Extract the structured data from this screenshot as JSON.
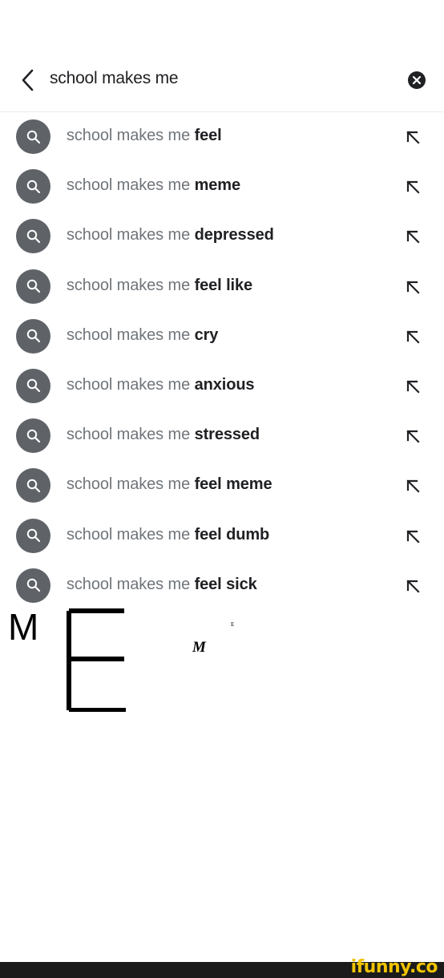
{
  "search": {
    "query": "school makes me",
    "back_icon": "chevron-left-icon",
    "clear_icon": "close-circle-icon"
  },
  "suggestions": [
    {
      "prefix": "school makes me ",
      "completion": "feel"
    },
    {
      "prefix": "school makes me ",
      "completion": "meme"
    },
    {
      "prefix": "school makes me ",
      "completion": "depressed"
    },
    {
      "prefix": "school makes me ",
      "completion": "feel like"
    },
    {
      "prefix": "school makes me ",
      "completion": "cry"
    },
    {
      "prefix": "school makes me ",
      "completion": "anxious"
    },
    {
      "prefix": "school makes me ",
      "completion": "stressed"
    },
    {
      "prefix": "school makes me ",
      "completion": "feel meme"
    },
    {
      "prefix": "school makes me ",
      "completion": "feel dumb"
    },
    {
      "prefix": "school makes me ",
      "completion": "feel sick"
    }
  ],
  "meme": {
    "big_m": "M",
    "big_e": "E",
    "small_m": "M",
    "tiny_e": "E"
  },
  "watermark": "ifunny.co",
  "colors": {
    "icon_circle": "#5f6368",
    "prefix_text": "#70757a",
    "completion_text": "#202124",
    "watermark": "#f0c300",
    "footer": "#1b1b1b"
  }
}
